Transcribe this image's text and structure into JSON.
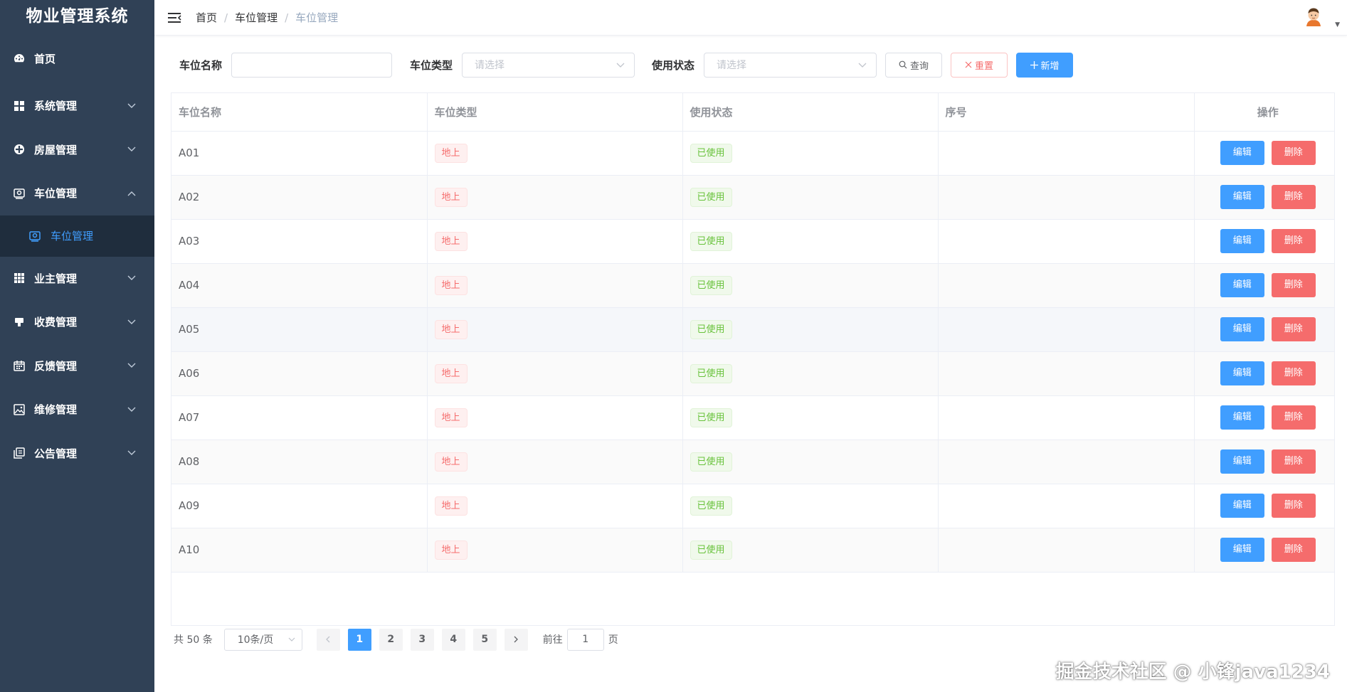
{
  "app": {
    "title": "物业管理系统"
  },
  "sidebar": {
    "items": [
      {
        "label": "首页",
        "icon": "dashboard-icon"
      },
      {
        "label": "系统管理",
        "icon": "grid-icon"
      },
      {
        "label": "房屋管理",
        "icon": "compass-icon"
      },
      {
        "label": "车位管理",
        "icon": "parking-icon"
      },
      {
        "label": "业主管理",
        "icon": "table-icon"
      },
      {
        "label": "收费管理",
        "icon": "stamp-icon"
      },
      {
        "label": "反馈管理",
        "icon": "calendar-icon"
      },
      {
        "label": "维修管理",
        "icon": "picture-icon"
      },
      {
        "label": "公告管理",
        "icon": "copy-icon"
      }
    ],
    "active_sub": {
      "label": "车位管理",
      "icon": "parking-icon"
    }
  },
  "header": {
    "breadcrumb": [
      "首页",
      "车位管理",
      "车位管理"
    ],
    "separator": "/"
  },
  "search": {
    "name_label": "车位名称",
    "name_value": "",
    "type_label": "车位类型",
    "type_placeholder": "请选择",
    "status_label": "使用状态",
    "status_placeholder": "请选择",
    "query_label": "查询",
    "reset_label": "重置",
    "add_label": "新增"
  },
  "table": {
    "columns": [
      "车位名称",
      "车位类型",
      "使用状态",
      "序号",
      "操作"
    ],
    "rows": [
      {
        "name": "A01",
        "type": "地上",
        "status": "已使用",
        "seq": ""
      },
      {
        "name": "A02",
        "type": "地上",
        "status": "已使用",
        "seq": ""
      },
      {
        "name": "A03",
        "type": "地上",
        "status": "已使用",
        "seq": ""
      },
      {
        "name": "A04",
        "type": "地上",
        "status": "已使用",
        "seq": ""
      },
      {
        "name": "A05",
        "type": "地上",
        "status": "已使用",
        "seq": ""
      },
      {
        "name": "A06",
        "type": "地上",
        "status": "已使用",
        "seq": ""
      },
      {
        "name": "A07",
        "type": "地上",
        "status": "已使用",
        "seq": ""
      },
      {
        "name": "A08",
        "type": "地上",
        "status": "已使用",
        "seq": ""
      },
      {
        "name": "A09",
        "type": "地上",
        "status": "已使用",
        "seq": ""
      },
      {
        "name": "A10",
        "type": "地上",
        "status": "已使用",
        "seq": ""
      }
    ],
    "edit_label": "编辑",
    "delete_label": "删除"
  },
  "pagination": {
    "total_text": "共 50 条",
    "page_size": "10条/页",
    "pages": [
      "1",
      "2",
      "3",
      "4",
      "5"
    ],
    "current_page": "1",
    "goto_label": "前往",
    "goto_value": "1",
    "page_suffix": "页"
  },
  "watermark": "掘金技术社区 @ 小锋java1234",
  "colors": {
    "sidebar_bg": "#304156",
    "sidebar_active_bg": "#1f2d3d",
    "primary": "#409eff",
    "danger": "#f56c6c",
    "success": "#67c23a"
  }
}
